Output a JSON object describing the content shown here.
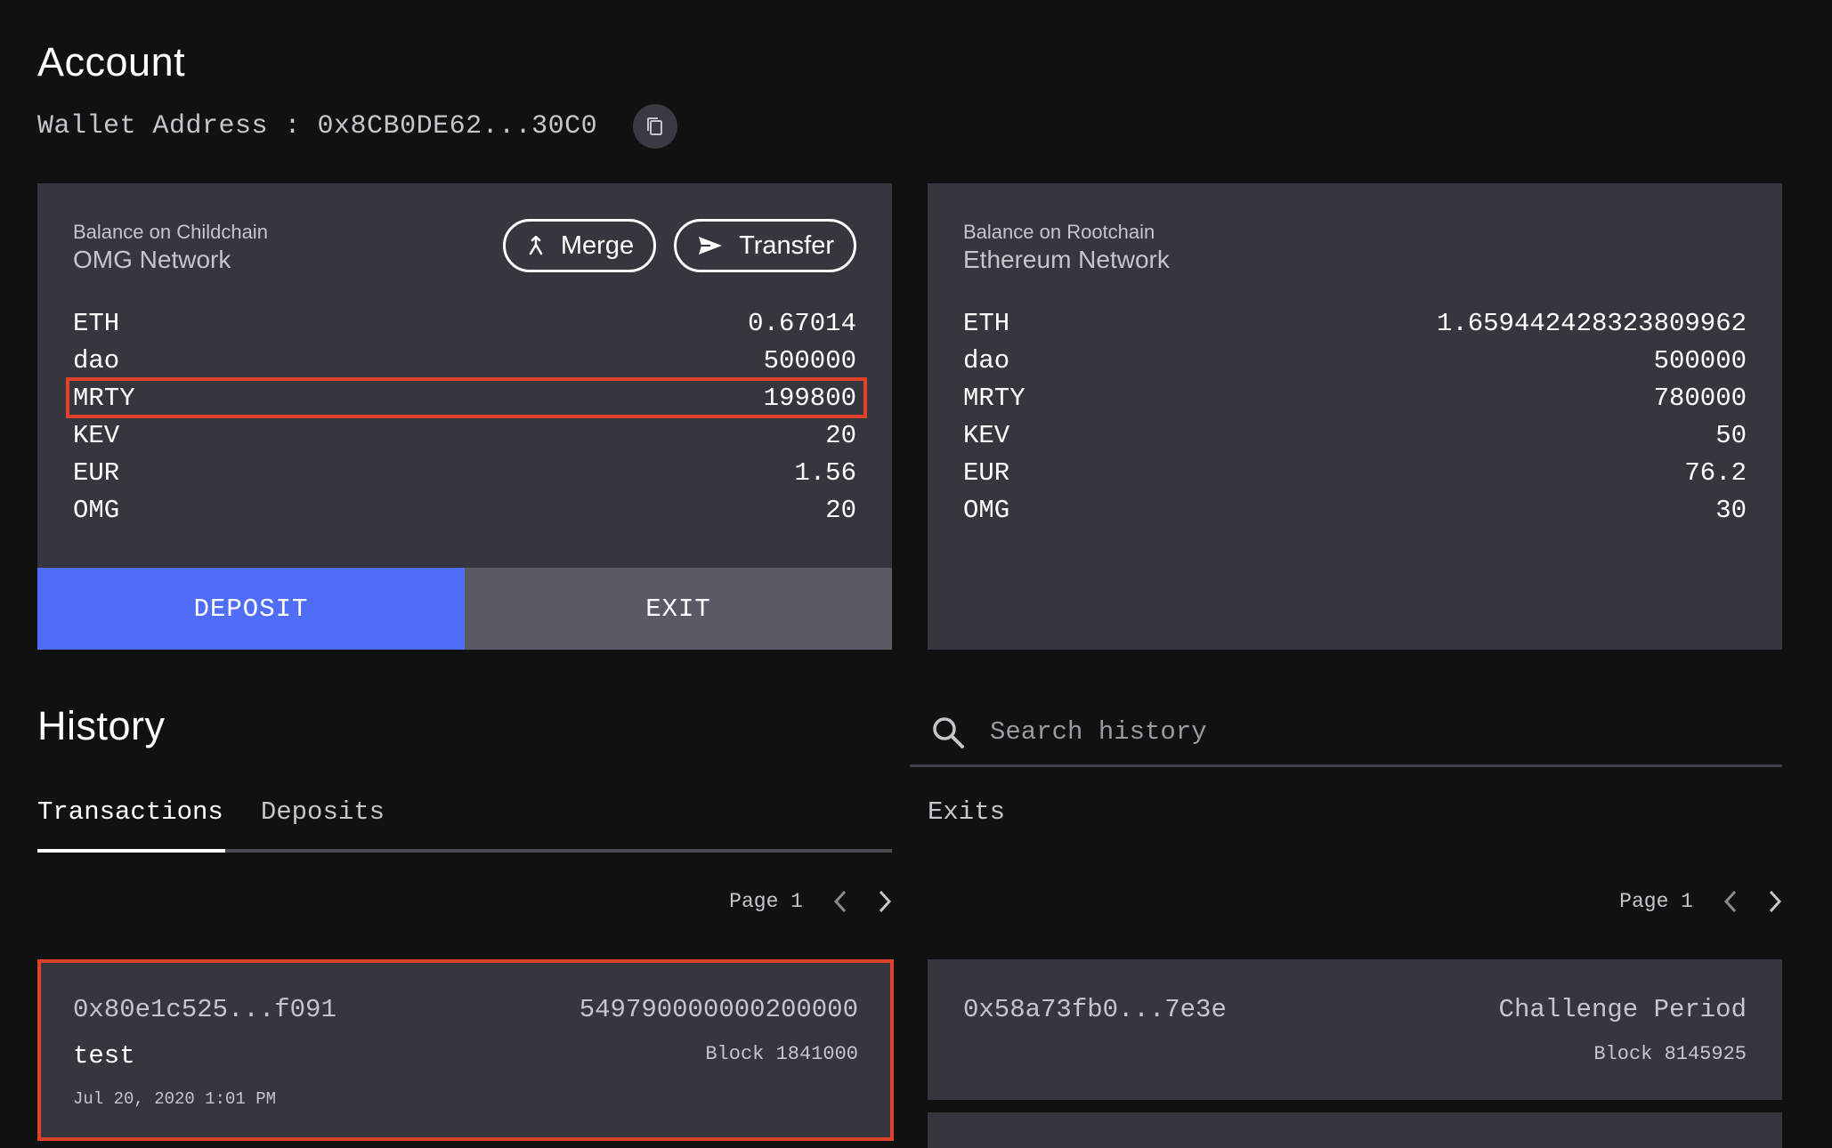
{
  "account": {
    "title": "Account",
    "wallet_label": "Wallet Address : 0x8CB0DE62...30C0"
  },
  "childchain": {
    "subtitle": "Balance on Childchain",
    "network": "OMG Network",
    "merge_label": "Merge",
    "transfer_label": "Transfer",
    "balances": [
      {
        "token": "ETH",
        "amount": "0.67014"
      },
      {
        "token": "dao",
        "amount": "500000"
      },
      {
        "token": "MRTY",
        "amount": "199800"
      },
      {
        "token": "KEV",
        "amount": "20"
      },
      {
        "token": "EUR",
        "amount": "1.56"
      },
      {
        "token": "OMG",
        "amount": "20"
      }
    ],
    "deposit_label": "DEPOSIT",
    "exit_label": "EXIT"
  },
  "rootchain": {
    "subtitle": "Balance on Rootchain",
    "network": "Ethereum Network",
    "balances": [
      {
        "token": "ETH",
        "amount": "1.659442428323809962"
      },
      {
        "token": "dao",
        "amount": "500000"
      },
      {
        "token": "MRTY",
        "amount": "780000"
      },
      {
        "token": "KEV",
        "amount": "50"
      },
      {
        "token": "EUR",
        "amount": "76.2"
      },
      {
        "token": "OMG",
        "amount": "30"
      }
    ]
  },
  "history": {
    "title": "History",
    "search_placeholder": "Search history",
    "tabs": [
      "Transactions",
      "Deposits"
    ],
    "exits_label": "Exits",
    "page_label": "Page 1"
  },
  "transactions": [
    {
      "hash": "0x80e1c525...f091",
      "amount": "549790000000200000",
      "memo": "test",
      "block": "Block 1841000",
      "date": "Jul 20, 2020 1:01 PM"
    }
  ],
  "exits": [
    {
      "hash": "0x58a73fb0...7e3e",
      "status": "Challenge Period",
      "block": "Block 8145925"
    }
  ],
  "colors": {
    "background": "#111112",
    "card": "#36363e",
    "deposit": "#4f6df6",
    "exit": "#5a5a66",
    "highlight": "#e0412b"
  }
}
